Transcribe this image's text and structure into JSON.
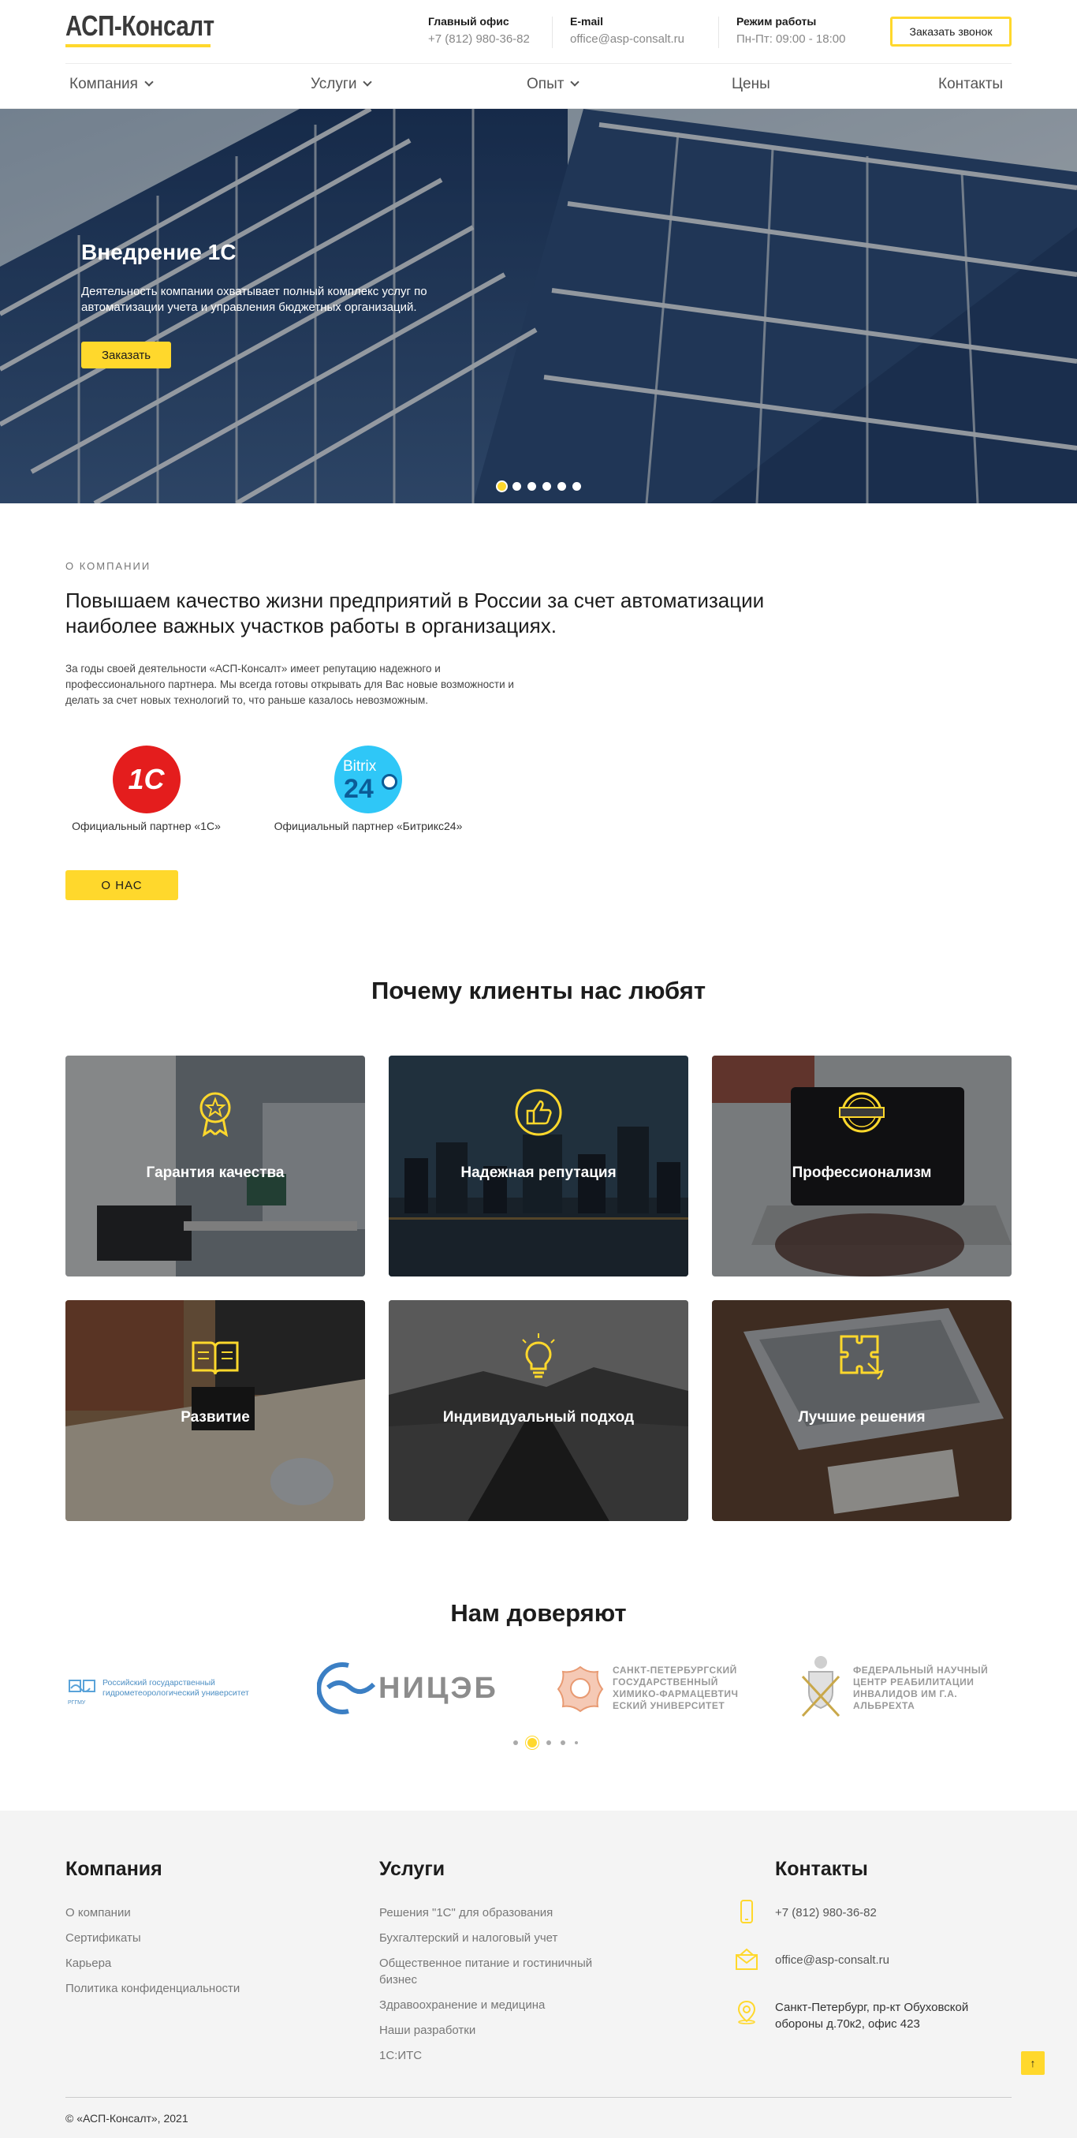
{
  "header": {
    "logo": "АСП-Консалт",
    "office_title": "Главный офис",
    "office_phone": "+7 (812) 980-36-82",
    "email_title": "E-mail",
    "email": "office@asp-consalt.ru",
    "hours_title": "Режим работы",
    "hours": "Пн-Пт: 09:00 - 18:00",
    "callback_label": "Заказать звонок"
  },
  "nav": {
    "items": [
      {
        "label": "Компания",
        "dropdown": true
      },
      {
        "label": "Услуги",
        "dropdown": true
      },
      {
        "label": "Опыт",
        "dropdown": true
      },
      {
        "label": "Цены",
        "dropdown": false
      },
      {
        "label": "Контакты",
        "dropdown": false
      }
    ]
  },
  "hero": {
    "title": "Внедрение 1С",
    "description": "Деятельность компании охватывает полный комплекс услуг по автоматизации учета и управления бюджетных организаций.",
    "button": "Заказать",
    "slides_total": 6,
    "active_slide": 1
  },
  "about": {
    "label": "О КОМПАНИИ",
    "title": "Повышаем качество жизни предприятий в России за счет автоматизации наиболее важных участков работы в организациях.",
    "text": "За годы своей деятельности «АСП-Консалт» имеет репутацию надежного и профессионального партнера. Мы всегда готовы открывать для Вас новые возможности и делать за счет новых технологий то, что раньше казалось невозможным.",
    "partners": [
      {
        "label": "Официальный партнер «1С»",
        "logo_text": "1С"
      },
      {
        "label": "Официальный партнер «Битрикс24»",
        "logo_text_1": "Bitrix",
        "logo_text_2": "24"
      }
    ],
    "button": "О НАС"
  },
  "why": {
    "title": "Почему клиенты нас любят",
    "cards": [
      {
        "label": "Гарантия качества",
        "icon": "award-icon"
      },
      {
        "label": "Надежная репутация",
        "icon": "thumbs-up-icon"
      },
      {
        "label": "Профессионализм",
        "icon": "certified-icon"
      },
      {
        "label": "Развитие",
        "icon": "book-icon"
      },
      {
        "label": "Индивидуальный подход",
        "icon": "lightbulb-icon"
      },
      {
        "label": "Лучшие решения",
        "icon": "puzzle-icon"
      }
    ]
  },
  "trust": {
    "title": "Нам доверяют",
    "logos": [
      {
        "text": "Российский государственный гидрометеорологический университет",
        "abbr": "РГГМУ"
      },
      {
        "text": "НИЦЭБ"
      },
      {
        "text": "САНКТ-ПЕТЕРБУРГСКИЙ ГОСУДАРСТВЕННЫЙ ХИМИКО-ФАРМАЦЕВТИЧ ЕСКИЙ УНИВЕРСИТЕТ"
      },
      {
        "text": "ФЕДЕРАЛЬНЫЙ НАУЧНЫЙ ЦЕНТР РЕАБИЛИТАЦИИ ИНВАЛИДОВ ИМ Г.А. АЛЬБРЕХТА"
      }
    ],
    "dots_total": 5,
    "active_dot": 2
  },
  "footer": {
    "company_title": "Компания",
    "company_links": [
      "О компании",
      "Сертификаты",
      "Карьера",
      "Политика конфиденциальности"
    ],
    "services_title": "Услуги",
    "services_links": [
      "Решения \"1С\" для образования",
      "Бухгалтерский и налоговый учет",
      "Общественное питание и гостиничный бизнес",
      "Здравоохранение и медицина",
      "Наши разработки",
      "1С:ИТС"
    ],
    "contacts_title": "Контакты",
    "phone": "+7 (812) 980-36-82",
    "email": "office@asp-consalt.ru",
    "address": "Санкт-Петербург, пр-кт Обуховской обороны д.70к2, офис 423",
    "copyright": "© «АСП-Консалт», 2021",
    "to_top": "↑"
  },
  "colors": {
    "accent": "#ffd82c",
    "text": "#1c1c1c",
    "footer_bg": "#f4f4f4"
  }
}
